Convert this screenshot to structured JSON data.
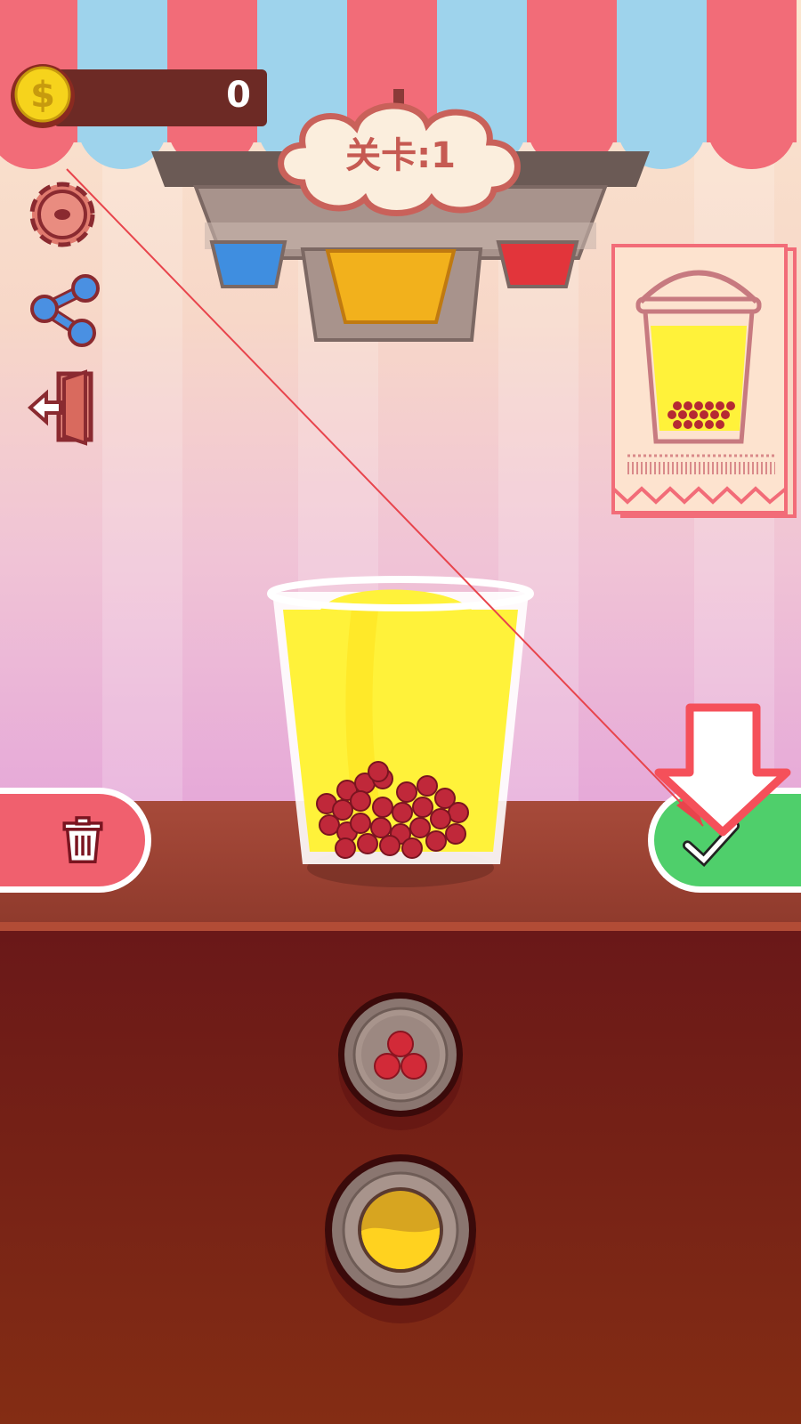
{
  "hud": {
    "coins": "0",
    "level_label": "关卡:1"
  },
  "side_buttons": [
    {
      "name": "settings-button",
      "icon": "gear-icon"
    },
    {
      "name": "share-button",
      "icon": "share-icon"
    },
    {
      "name": "exit-button",
      "icon": "exit-door-icon"
    }
  ],
  "dispensers": [
    {
      "name": "blue-syrup-nozzle",
      "color": "#3f8ee0"
    },
    {
      "name": "yellow-syrup-nozzle",
      "color": "#f2b11c"
    },
    {
      "name": "red-syrup-nozzle",
      "color": "#e2353b"
    }
  ],
  "order": {
    "drink_color": "#fff23a",
    "topping": "red-pearls"
  },
  "actions": {
    "trash_icon": "trash-icon",
    "confirm_icon": "check-icon"
  },
  "ingredient_buttons": [
    {
      "name": "pearls-button",
      "icon": "red-pearls-icon"
    },
    {
      "name": "mango-juice-button",
      "icon": "yellow-juice-icon"
    }
  ],
  "colors": {
    "awning_red": "#f26c78",
    "awning_blue": "#9ed3ec",
    "trash_red": "#f0606e",
    "confirm_green": "#4fcf6b",
    "hint_arrow_red": "#f5505a"
  }
}
